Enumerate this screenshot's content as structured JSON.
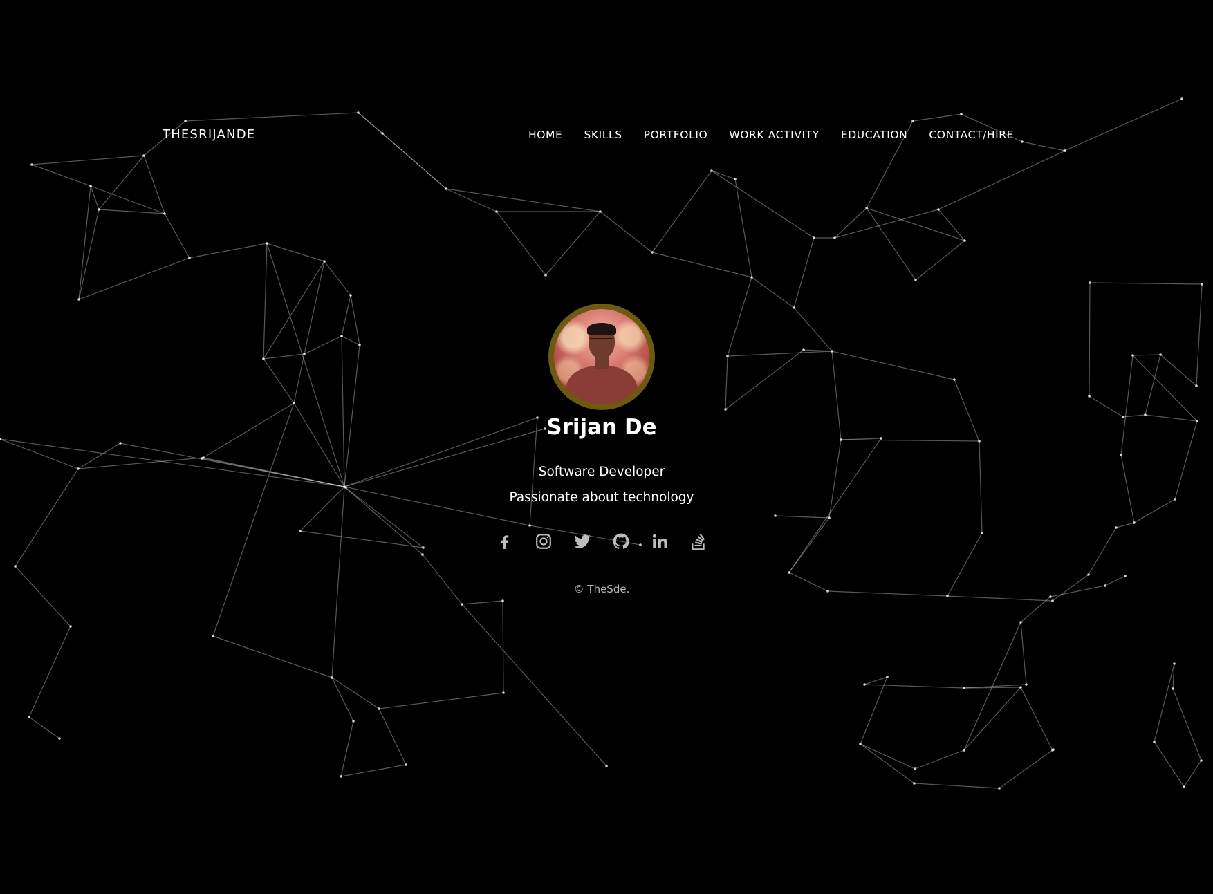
{
  "brand": "THESRIJANDE",
  "nav": {
    "items": [
      "HOME",
      "SKILLS",
      "PORTFOLIO",
      "WORK ACTIVITY",
      "EDUCATION",
      "CONTACT/HIRE"
    ]
  },
  "profile": {
    "name": "Srijan De",
    "role": "Software Developer",
    "tagline": "Passionate about technology",
    "avatar_ring_color": "#6b5a10"
  },
  "social": {
    "icons": [
      "facebook-icon",
      "instagram-icon",
      "twitter-icon",
      "github-icon",
      "linkedin-icon",
      "stackoverflow-icon"
    ],
    "icon_color": "#bdbdbd"
  },
  "footer": {
    "copyright": "© TheSde."
  },
  "colors": {
    "background": "#000000",
    "network_lines": "#ffffff"
  }
}
